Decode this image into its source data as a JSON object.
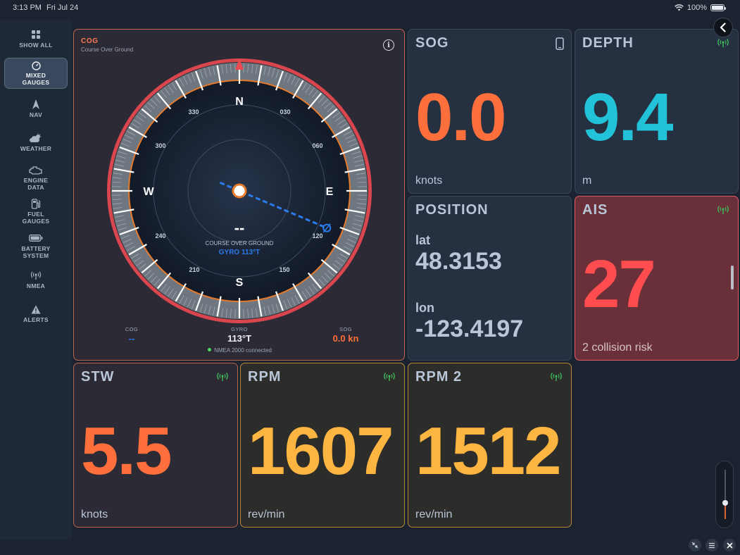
{
  "status": {
    "time": "3:13 PM",
    "date": "Fri Jul 24",
    "battery": "100%"
  },
  "sidebar": {
    "items": [
      {
        "label1": "SHOW ALL",
        "label2": ""
      },
      {
        "label1": "MIXED",
        "label2": "GAUGES"
      },
      {
        "label1": "NAV",
        "label2": ""
      },
      {
        "label1": "WEATHER",
        "label2": ""
      },
      {
        "label1": "ENGINE",
        "label2": "DATA"
      },
      {
        "label1": "FUEL",
        "label2": "GAUGES"
      },
      {
        "label1": "BATTERY",
        "label2": "SYSTEM"
      },
      {
        "label1": "NMEA",
        "label2": ""
      },
      {
        "label1": "ALERTS",
        "label2": ""
      }
    ],
    "active": "MIXED GAUGES"
  },
  "cog": {
    "title": "COG",
    "subtitle": "Course Over Ground",
    "center_value": "--",
    "center_label": "COURSE OVER GROUND",
    "gyro_readout": "GYRO 113°T",
    "heading_deg": 113,
    "cardinals": {
      "n": "N",
      "e": "E",
      "s": "S",
      "w": "W"
    },
    "degree_labels": [
      "030",
      "060",
      "120",
      "150",
      "210",
      "240",
      "300",
      "330"
    ],
    "footer": {
      "cog_label": "COG",
      "cog_value": "--",
      "gyro_label": "GYRO",
      "gyro_value": "113°T",
      "sog_label": "SOG",
      "sog_value": "0.0 kn"
    },
    "connection": "NMEA 2000 connected",
    "colors": {
      "bezel": "#d9464e",
      "orange_ring": "#e57a2c",
      "heading": "#2b7bea"
    }
  },
  "sog": {
    "title": "SOG",
    "value": "0.0",
    "unit": "knots",
    "color": "#ff6f3c"
  },
  "depth": {
    "title": "DEPTH",
    "value": "9.4",
    "unit": "m",
    "color": "#22c3d8"
  },
  "position": {
    "title": "POSITION",
    "lat_label": "lat",
    "lat": "48.3153",
    "lon_label": "lon",
    "lon": "-123.4197"
  },
  "ais": {
    "title": "AIS",
    "value": "27",
    "subtitle": "2 collision risk",
    "color": "#ff4d4f"
  },
  "stw": {
    "title": "STW",
    "value": "5.5",
    "unit": "knots",
    "color": "#ff6f3c"
  },
  "rpm": {
    "title": "RPM",
    "value": "1607",
    "unit": "rev/min",
    "color": "#fdb541"
  },
  "rpm2": {
    "title": "RPM 2",
    "value": "1512",
    "unit": "rev/min",
    "color": "#fdb541"
  },
  "icons": {
    "signal": "signal-icon",
    "phone": "phone-icon",
    "info": "info-icon",
    "back": "chevron-left-icon"
  },
  "brightness_level": 0.33
}
